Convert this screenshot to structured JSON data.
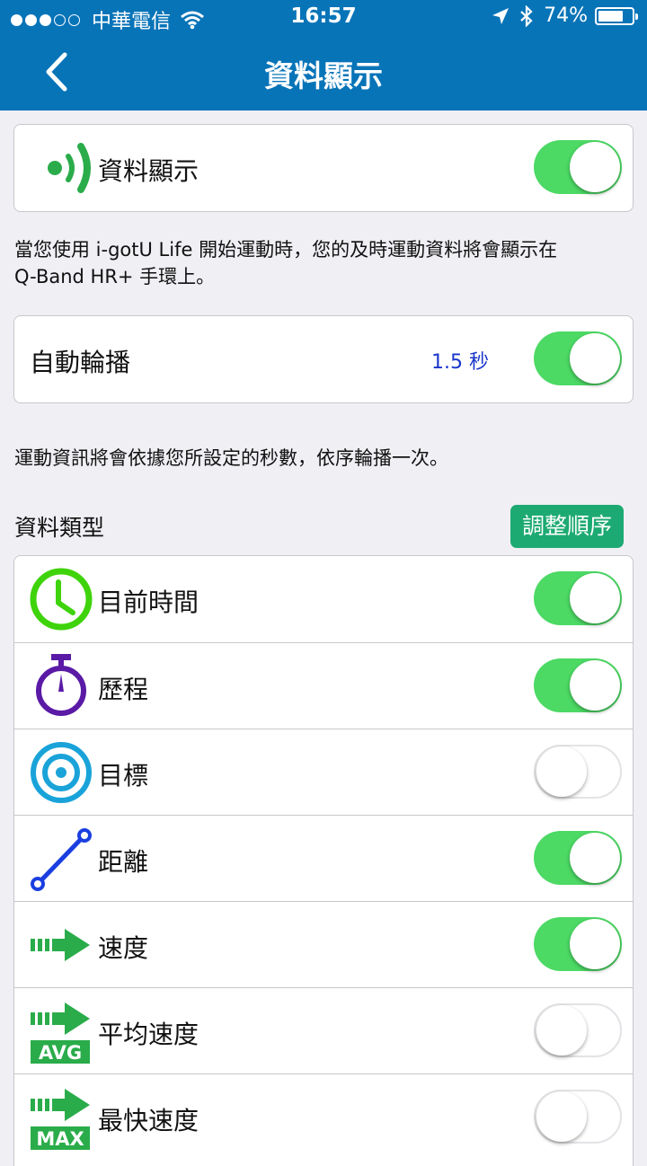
{
  "status_bar": {
    "carrier": "中華電信",
    "time": "16:57",
    "battery": "74%",
    "battery_level": 0.74
  },
  "nav": {
    "title": "資料顯示"
  },
  "main_toggle": {
    "label": "資料顯示",
    "on": true
  },
  "description_1": {
    "line1": "當您使用 i-gotU Life 開始運動時，您的及時運動資料將會顯示在",
    "line2": "Q-Band HR+ 手環上。"
  },
  "auto_play": {
    "label": "自動輪播",
    "interval": "1.5 秒",
    "on": true
  },
  "description_2": "運動資訊將會依據您所設定的秒數，依序輪播一次。",
  "data_types": {
    "title": "資料類型",
    "reorder_label": "調整順序",
    "items": [
      {
        "label": "目前時間",
        "icon": "clock-icon",
        "on": true
      },
      {
        "label": "歷程",
        "icon": "stopwatch-icon",
        "on": true
      },
      {
        "label": "目標",
        "icon": "target-icon",
        "on": false
      },
      {
        "label": "距離",
        "icon": "distance-icon",
        "on": true
      },
      {
        "label": "速度",
        "icon": "speed-arrow-icon",
        "on": true
      },
      {
        "label": "平均速度",
        "icon": "avg-speed-icon",
        "badge": "AVG",
        "on": false
      },
      {
        "label": "最快速度",
        "icon": "max-speed-icon",
        "badge": "MAX",
        "on": false
      }
    ]
  },
  "colors": {
    "nav_bar": "#0874b8",
    "toggle_on": "#4cd964",
    "reorder_button": "#1daa72",
    "interval_text": "#1a36cc",
    "clock_icon": "#3ed30b",
    "stopwatch_icon": "#5a1aa6",
    "target_icon": "#1aa3d9",
    "distance_icon": "#1a3fe0",
    "arrow_icon": "#2aac4a"
  }
}
